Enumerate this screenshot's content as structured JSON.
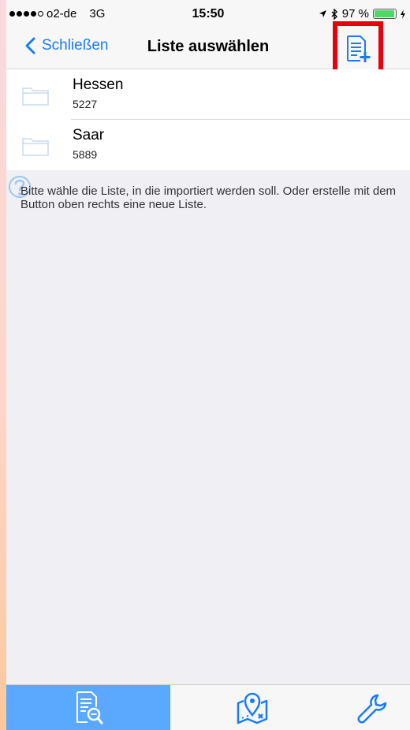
{
  "status_bar": {
    "carrier": "o2-de",
    "network": "3G",
    "time": "15:50",
    "battery": "97 %",
    "battery_level": 0.97
  },
  "nav": {
    "back_label": "Schließen",
    "title": "Liste auswählen",
    "add_icon": "add-list-icon"
  },
  "lists": [
    {
      "name": "Hessen",
      "count": "5227",
      "icon": "folder-icon"
    },
    {
      "name": "Saar",
      "count": "5889",
      "icon": "folder-icon"
    }
  ],
  "hint": "Bitte wähle die Liste, in die importiert werden soll. Oder erstelle mit dem Button oben rechts eine neue Liste.",
  "tabs": [
    {
      "icon": "document-search-icon",
      "active": true
    },
    {
      "icon": "map-pin-icon",
      "active": false
    },
    {
      "icon": "wrench-icon",
      "active": false
    }
  ],
  "colors": {
    "accent": "#1a7cf2",
    "highlight_box": "#e8000c",
    "active_tab": "#5aa8ff",
    "battery": "#4cd964"
  }
}
